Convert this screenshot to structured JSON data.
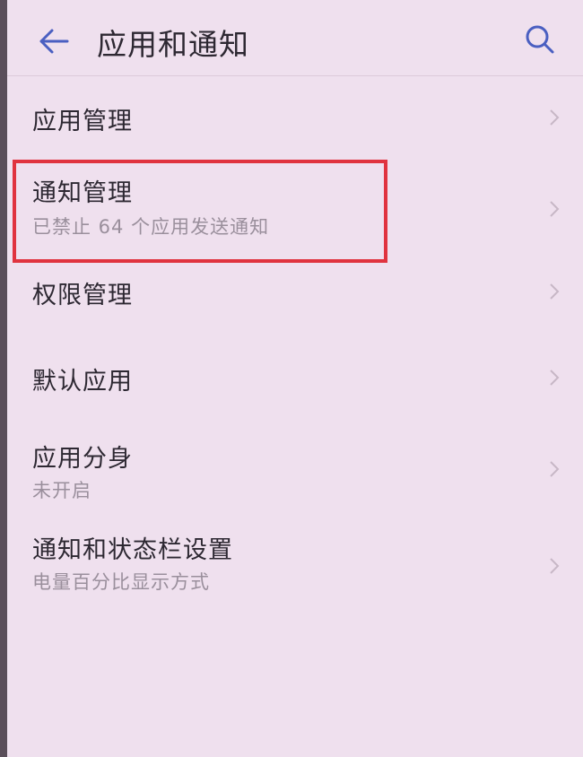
{
  "header": {
    "title": "应用和通知"
  },
  "items": [
    {
      "label": "应用管理",
      "sublabel": ""
    },
    {
      "label": "通知管理",
      "sublabel": "已禁止 64 个应用发送通知"
    },
    {
      "label": "权限管理",
      "sublabel": ""
    },
    {
      "label": "默认应用",
      "sublabel": ""
    },
    {
      "label": "应用分身",
      "sublabel": "未开启"
    },
    {
      "label": "通知和状态栏设置",
      "sublabel": "电量百分比显示方式"
    }
  ],
  "colors": {
    "background": "#efe0ee",
    "accent": "#4a5fc1",
    "highlight": "#e0333f"
  },
  "icons": {
    "back": "arrow-left-icon",
    "search": "search-icon",
    "chevron": "chevron-right-icon"
  }
}
